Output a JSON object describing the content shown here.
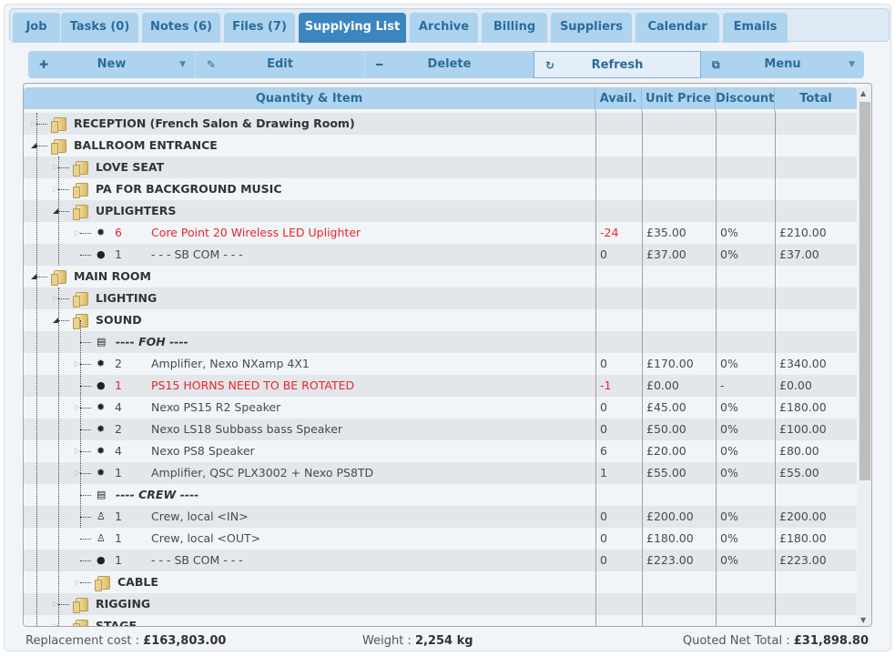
{
  "tabs": [
    {
      "label": "Job",
      "active": false
    },
    {
      "label": "Tasks (0)",
      "active": false
    },
    {
      "label": "Notes (6)",
      "active": false
    },
    {
      "label": "Files (7)",
      "active": false
    },
    {
      "label": "Supplying List",
      "active": true
    },
    {
      "label": "Archive",
      "active": false
    },
    {
      "label": "Billing",
      "active": false
    },
    {
      "label": "Suppliers",
      "active": false
    },
    {
      "label": "Calendar",
      "active": false
    },
    {
      "label": "Emails",
      "active": false
    }
  ],
  "toolbar": {
    "new_label": "New",
    "edit_label": "Edit",
    "delete_label": "Delete",
    "refresh_label": "Refresh",
    "menu_label": "Menu"
  },
  "grid": {
    "columns": [
      "Quantity & Item",
      "Avail.",
      "Unit Price",
      "Discount",
      "Total"
    ],
    "rows": [
      {
        "type": "folder",
        "level": 0,
        "state": "closed",
        "label": "RECEPTION (French Salon & Drawing Room)"
      },
      {
        "type": "folder",
        "level": 0,
        "state": "open",
        "label": "BALLROOM ENTRANCE"
      },
      {
        "type": "folder",
        "level": 1,
        "state": "closed",
        "label": "LOVE SEAT"
      },
      {
        "type": "folder",
        "level": 1,
        "state": "closed",
        "label": "PA FOR BACKGROUND MUSIC"
      },
      {
        "type": "folder",
        "level": 1,
        "state": "open",
        "label": "UPLIGHTERS"
      },
      {
        "type": "item",
        "level": 2,
        "icon": "gear",
        "expandable": true,
        "qty": "6",
        "label": "Core Point 20 Wireless LED Uplighter",
        "avail": "-24",
        "price": "£35.00",
        "discount": "0%",
        "total": "£210.00",
        "alert": true
      },
      {
        "type": "item",
        "level": 2,
        "icon": "circle",
        "expandable": false,
        "qty": "1",
        "label": "- - - SB COM - - -",
        "avail": "0",
        "price": "£37.00",
        "discount": "0%",
        "total": "£37.00",
        "alert": false
      },
      {
        "type": "folder",
        "level": 0,
        "state": "open",
        "label": "MAIN ROOM"
      },
      {
        "type": "folder",
        "level": 1,
        "state": "closed",
        "label": "LIGHTING"
      },
      {
        "type": "folder",
        "level": 1,
        "state": "open",
        "label": "SOUND"
      },
      {
        "type": "note",
        "level": 2,
        "label": "---- FOH ----"
      },
      {
        "type": "item",
        "level": 2,
        "icon": "gear",
        "expandable": true,
        "qty": "2",
        "label": "Amplifier, Nexo NXamp 4X1",
        "avail": "0",
        "price": "£170.00",
        "discount": "0%",
        "total": "£340.00",
        "alert": false
      },
      {
        "type": "item",
        "level": 2,
        "icon": "circle",
        "expandable": false,
        "qty": "1",
        "label": "PS15 HORNS NEED TO BE ROTATED",
        "avail": "-1",
        "price": "£0.00",
        "discount": "-",
        "total": "£0.00",
        "alert": true
      },
      {
        "type": "item",
        "level": 2,
        "icon": "gear",
        "expandable": true,
        "qty": "4",
        "label": "Nexo PS15 R2 Speaker",
        "avail": "0",
        "price": "£45.00",
        "discount": "0%",
        "total": "£180.00",
        "alert": false
      },
      {
        "type": "item",
        "level": 2,
        "icon": "gear",
        "expandable": false,
        "qty": "2",
        "label": "Nexo LS18 Subbass bass Speaker",
        "avail": "0",
        "price": "£50.00",
        "discount": "0%",
        "total": "£100.00",
        "alert": false
      },
      {
        "type": "item",
        "level": 2,
        "icon": "gear",
        "expandable": true,
        "qty": "4",
        "label": "Nexo PS8 Speaker",
        "avail": "6",
        "price": "£20.00",
        "discount": "0%",
        "total": "£80.00",
        "alert": false
      },
      {
        "type": "item",
        "level": 2,
        "icon": "gear",
        "expandable": true,
        "qty": "1",
        "label": "Amplifier, QSC PLX3002 + Nexo PS8TD",
        "avail": "1",
        "price": "£55.00",
        "discount": "0%",
        "total": "£55.00",
        "alert": false
      },
      {
        "type": "note",
        "level": 2,
        "label": "---- CREW ----"
      },
      {
        "type": "item",
        "level": 2,
        "icon": "person",
        "expandable": false,
        "qty": "1",
        "label": "Crew, local <IN>",
        "avail": "0",
        "price": "£200.00",
        "discount": "0%",
        "total": "£200.00",
        "alert": false
      },
      {
        "type": "item",
        "level": 2,
        "icon": "person",
        "expandable": false,
        "qty": "1",
        "label": "Crew, local <OUT>",
        "avail": "0",
        "price": "£180.00",
        "discount": "0%",
        "total": "£180.00",
        "alert": false
      },
      {
        "type": "item",
        "level": 2,
        "icon": "circle",
        "expandable": false,
        "qty": "1",
        "label": "- - - SB COM - - -",
        "avail": "0",
        "price": "£223.00",
        "discount": "0%",
        "total": "£223.00",
        "alert": false
      },
      {
        "type": "folder",
        "level": 2,
        "state": "closed",
        "label": "CABLE"
      },
      {
        "type": "folder",
        "level": 1,
        "state": "closed",
        "label": "RIGGING"
      },
      {
        "type": "folder",
        "level": 1,
        "state": "closed",
        "label": "STAGE"
      }
    ]
  },
  "footer": {
    "replacement_label": "Replacement cost : ",
    "replacement_value": "£163,803.00",
    "weight_label": "Weight : ",
    "weight_value": "2,254 kg",
    "net_label": "Quoted Net Total : ",
    "net_value": "£31,898.80"
  },
  "colors": {
    "accent": "#3c86c0",
    "tab_bg": "#aed3ef",
    "alert": "#e8262c"
  }
}
